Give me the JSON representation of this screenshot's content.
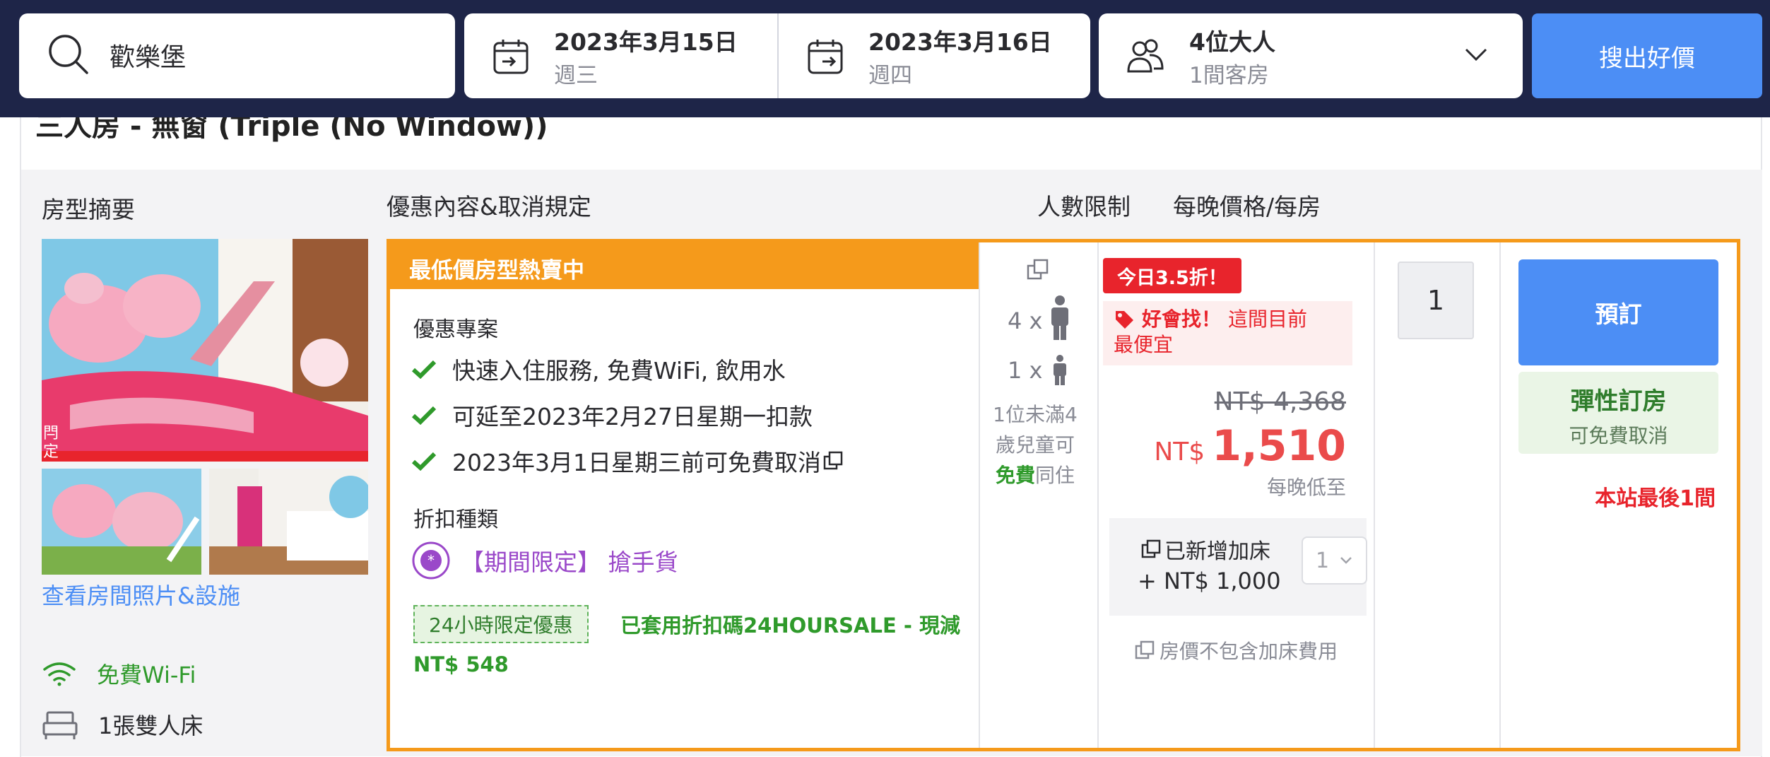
{
  "search": {
    "destination": "歡樂堡",
    "checkin_date": "2023年3月15日",
    "checkin_day": "週三",
    "checkout_date": "2023年3月16日",
    "checkout_day": "週四",
    "guests": "4位大人",
    "rooms": "1間客房",
    "submit_label": "搜出好價"
  },
  "room": {
    "title": "三人房 - 無窗 (Triple (No Window))",
    "col_summary": "房型摘要",
    "col_offer": "優惠內容&取消規定",
    "col_occupancy": "人數限制",
    "col_price": "每晚價格/每房",
    "photos_link": "查看房間照片&設施",
    "amenities": [
      "免費Wi-Fi",
      "1張雙人床"
    ]
  },
  "offer": {
    "ribbon": "最低價房型熱賣中",
    "benefits_title": "優惠專案",
    "benefits": [
      "快速入住服務, 免費WiFi, 飲用水",
      "可延至2023年2月27日星期一扣款",
      "2023年3月1日星期三前可免費取消"
    ],
    "discount_title": "折扣種類",
    "promo_label": "【期間限定】 搶手貨",
    "coupon_tag": "24小時限定優惠",
    "coupon_text_1": "已套用折扣碼24HOURSALE - 現減",
    "coupon_text_2": "NT$ 548"
  },
  "occupancy": {
    "adults": "4 x",
    "children": "1 x",
    "note_1": "1位未滿4",
    "note_2": "歲兒童可",
    "note_free": "免費",
    "note_3": "同住"
  },
  "price": {
    "deal_badge": "今日3.5折！",
    "good_find_label": "好會找！",
    "good_find_text_1": "這間目前",
    "good_find_text_2": "最便宜",
    "original": "NT$ 4,368",
    "currency": "NT$",
    "current": "1,510",
    "per_night_label": "每晚低至",
    "extra_bed_label": "已新增加床",
    "extra_bed_price": "+ NT$ 1,000",
    "extra_bed_qty": "1",
    "extra_bed_note": "房價不包含加床費用"
  },
  "booking": {
    "qty": "1",
    "book_label": "預訂",
    "flex_title": "彈性訂房",
    "flex_sub": "可免費取消",
    "last_room": "本站最後1間"
  },
  "colors": {
    "nav_bg": "#1e2548",
    "accent_blue": "#4c8ef5",
    "orange": "#f59a1b",
    "red": "#e8242c",
    "green": "#2f9a2b",
    "purple": "#9a48c9"
  }
}
